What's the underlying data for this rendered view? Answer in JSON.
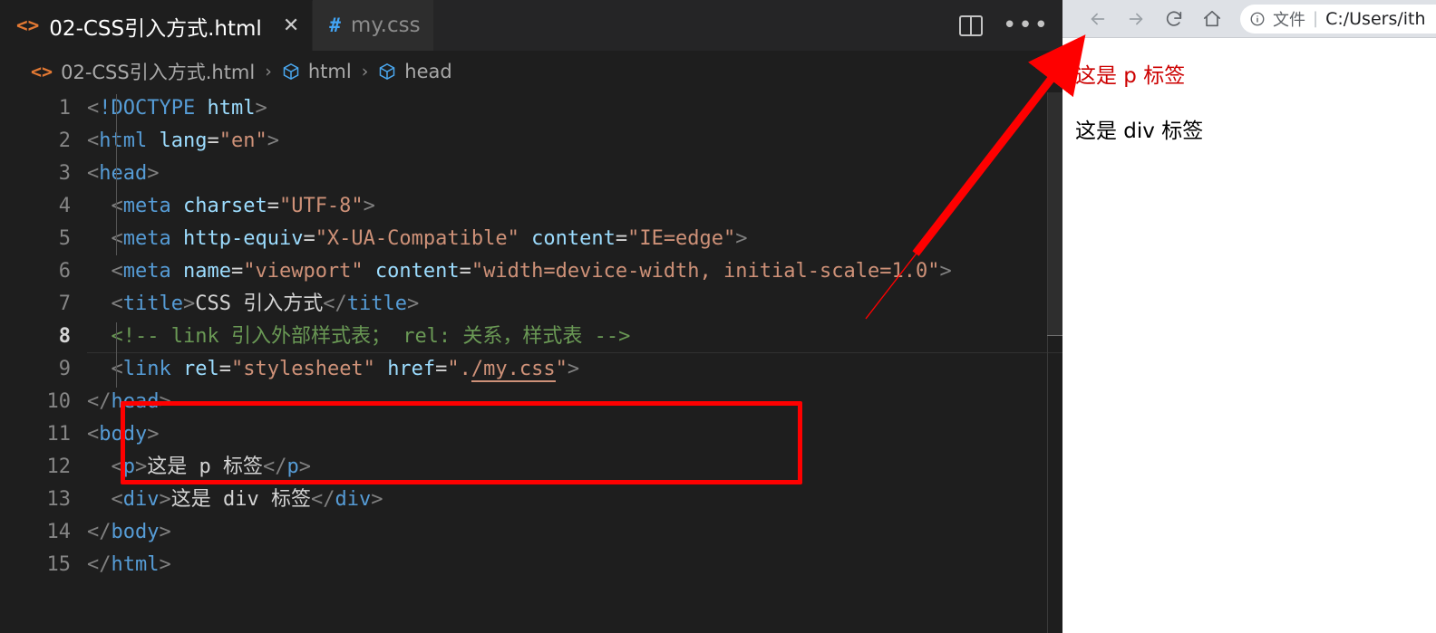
{
  "window": {
    "app": "vscode-editor",
    "accent_red": "#fe0000",
    "editor_bg": "#1e1e1e"
  },
  "tabs": [
    {
      "label": "02-CSS引入方式.html",
      "icon": "html-file-icon",
      "icon_glyph": "<>",
      "active": true,
      "close_glyph": "✕"
    },
    {
      "label": "my.css",
      "icon": "css-file-icon",
      "icon_glyph": "#",
      "active": false,
      "close_glyph": ""
    }
  ],
  "tab_actions": {
    "split_editor": "split-editor-icon",
    "more_actions": "•••"
  },
  "breadcrumb": {
    "file_icon_glyph": "<>",
    "items": [
      {
        "label": "02-CSS引入方式.html",
        "icon": "html-file-icon"
      },
      {
        "label": "html",
        "icon": "symbol-cube-icon"
      },
      {
        "label": "head",
        "icon": "symbol-cube-icon"
      }
    ],
    "separator": "›"
  },
  "editor": {
    "active_line": 8,
    "lines": [
      {
        "n": "1",
        "tokens": [
          {
            "t": "punct",
            "v": "<"
          },
          {
            "t": "doctype",
            "v": "!DOCTYPE "
          },
          {
            "t": "attr",
            "v": "html"
          },
          {
            "t": "punct",
            "v": ">"
          }
        ]
      },
      {
        "n": "2",
        "tokens": [
          {
            "t": "punct",
            "v": "<"
          },
          {
            "t": "tag",
            "v": "html"
          },
          {
            "t": "text",
            "v": " "
          },
          {
            "t": "attr",
            "v": "lang"
          },
          {
            "t": "eq",
            "v": "="
          },
          {
            "t": "str",
            "v": "\"en\""
          },
          {
            "t": "punct",
            "v": ">"
          }
        ]
      },
      {
        "n": "3",
        "tokens": [
          {
            "t": "punct",
            "v": "<"
          },
          {
            "t": "tag",
            "v": "head"
          },
          {
            "t": "punct",
            "v": ">"
          }
        ]
      },
      {
        "n": "4",
        "tokens": [
          {
            "t": "text",
            "v": "  "
          },
          {
            "t": "punct",
            "v": "<"
          },
          {
            "t": "tag",
            "v": "meta"
          },
          {
            "t": "text",
            "v": " "
          },
          {
            "t": "attr",
            "v": "charset"
          },
          {
            "t": "eq",
            "v": "="
          },
          {
            "t": "str",
            "v": "\"UTF-8\""
          },
          {
            "t": "punct",
            "v": ">"
          }
        ]
      },
      {
        "n": "5",
        "tokens": [
          {
            "t": "text",
            "v": "  "
          },
          {
            "t": "punct",
            "v": "<"
          },
          {
            "t": "tag",
            "v": "meta"
          },
          {
            "t": "text",
            "v": " "
          },
          {
            "t": "attr",
            "v": "http-equiv"
          },
          {
            "t": "eq",
            "v": "="
          },
          {
            "t": "str",
            "v": "\"X-UA-Compatible\""
          },
          {
            "t": "text",
            "v": " "
          },
          {
            "t": "attr",
            "v": "content"
          },
          {
            "t": "eq",
            "v": "="
          },
          {
            "t": "str",
            "v": "\"IE=edge\""
          },
          {
            "t": "punct",
            "v": ">"
          }
        ]
      },
      {
        "n": "6",
        "tokens": [
          {
            "t": "text",
            "v": "  "
          },
          {
            "t": "punct",
            "v": "<"
          },
          {
            "t": "tag",
            "v": "meta"
          },
          {
            "t": "text",
            "v": " "
          },
          {
            "t": "attr",
            "v": "name"
          },
          {
            "t": "eq",
            "v": "="
          },
          {
            "t": "str",
            "v": "\"viewport\""
          },
          {
            "t": "text",
            "v": " "
          },
          {
            "t": "attr",
            "v": "content"
          },
          {
            "t": "eq",
            "v": "="
          },
          {
            "t": "str",
            "v": "\"width=device-width, initial-scale=1.0\""
          },
          {
            "t": "punct",
            "v": ">"
          }
        ]
      },
      {
        "n": "7",
        "tokens": [
          {
            "t": "text",
            "v": "  "
          },
          {
            "t": "punct",
            "v": "<"
          },
          {
            "t": "tag",
            "v": "title"
          },
          {
            "t": "punct",
            "v": ">"
          },
          {
            "t": "text",
            "v": "CSS 引入方式"
          },
          {
            "t": "punct",
            "v": "</"
          },
          {
            "t": "tag",
            "v": "title"
          },
          {
            "t": "punct",
            "v": ">"
          }
        ]
      },
      {
        "n": "8",
        "tokens": [
          {
            "t": "text",
            "v": "  "
          },
          {
            "t": "comment",
            "v": "<!-- link 引入外部样式表； rel: 关系，样式表 -->"
          }
        ]
      },
      {
        "n": "9",
        "tokens": [
          {
            "t": "text",
            "v": "  "
          },
          {
            "t": "punct",
            "v": "<"
          },
          {
            "t": "tag",
            "v": "link"
          },
          {
            "t": "text",
            "v": " "
          },
          {
            "t": "attr",
            "v": "rel"
          },
          {
            "t": "eq",
            "v": "="
          },
          {
            "t": "str",
            "v": "\"stylesheet\""
          },
          {
            "t": "text",
            "v": " "
          },
          {
            "t": "attr",
            "v": "href"
          },
          {
            "t": "eq",
            "v": "="
          },
          {
            "t": "str",
            "v": "\"."
          },
          {
            "t": "str-link",
            "v": "/my.css"
          },
          {
            "t": "str",
            "v": "\""
          },
          {
            "t": "punct",
            "v": ">"
          }
        ]
      },
      {
        "n": "10",
        "tokens": [
          {
            "t": "punct",
            "v": "</"
          },
          {
            "t": "tag",
            "v": "head"
          },
          {
            "t": "punct",
            "v": ">"
          }
        ]
      },
      {
        "n": "11",
        "tokens": [
          {
            "t": "punct",
            "v": "<"
          },
          {
            "t": "tag",
            "v": "body"
          },
          {
            "t": "punct",
            "v": ">"
          }
        ]
      },
      {
        "n": "12",
        "tokens": [
          {
            "t": "text",
            "v": "  "
          },
          {
            "t": "punct",
            "v": "<"
          },
          {
            "t": "tag",
            "v": "p"
          },
          {
            "t": "punct",
            "v": ">"
          },
          {
            "t": "text",
            "v": "这是 p 标签"
          },
          {
            "t": "punct",
            "v": "</"
          },
          {
            "t": "tag",
            "v": "p"
          },
          {
            "t": "punct",
            "v": ">"
          }
        ]
      },
      {
        "n": "13",
        "tokens": [
          {
            "t": "text",
            "v": "  "
          },
          {
            "t": "punct",
            "v": "<"
          },
          {
            "t": "tag",
            "v": "div"
          },
          {
            "t": "punct",
            "v": ">"
          },
          {
            "t": "text",
            "v": "这是 div 标签"
          },
          {
            "t": "punct",
            "v": "</"
          },
          {
            "t": "tag",
            "v": "div"
          },
          {
            "t": "punct",
            "v": ">"
          }
        ]
      },
      {
        "n": "14",
        "tokens": [
          {
            "t": "punct",
            "v": "</"
          },
          {
            "t": "tag",
            "v": "body"
          },
          {
            "t": "punct",
            "v": ">"
          }
        ]
      },
      {
        "n": "15",
        "tokens": [
          {
            "t": "punct",
            "v": "</"
          },
          {
            "t": "tag",
            "v": "html"
          },
          {
            "t": "punct",
            "v": ">"
          }
        ]
      }
    ]
  },
  "annotations": {
    "highlight_box": {
      "label": "red-highlight-box",
      "color": "#fe0000",
      "covers_lines": "8-9"
    },
    "arrow": {
      "label": "red-arrow",
      "color": "#fe0000",
      "from": "line-8-9-block",
      "to": "browser-p-text"
    }
  },
  "browser": {
    "nav": {
      "back": "back-arrow-icon",
      "forward": "forward-arrow-icon",
      "reload": "reload-icon",
      "home": "home-icon"
    },
    "omnibox": {
      "info_icon": "info-circle-icon",
      "scheme_label": "文件",
      "divider": "|",
      "url": "C:/Users/ith"
    },
    "page": {
      "p_text": "这是 p 标签",
      "p_color": "#cc0000",
      "div_text": "这是 div 标签",
      "div_color": "#000000"
    }
  }
}
